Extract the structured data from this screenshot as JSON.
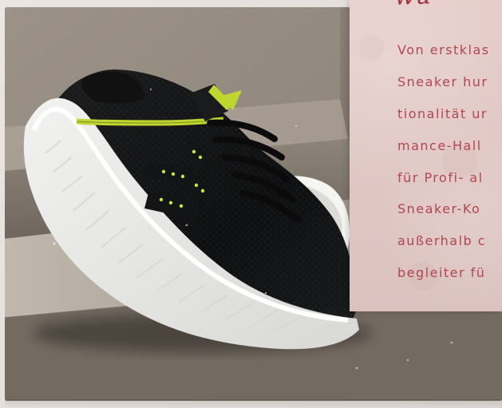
{
  "text_card": {
    "heading": "wu",
    "lines": [
      "Von erstklas",
      "Sneaker hur",
      "tionalität ur",
      "mance-Hall",
      "für Profi- al",
      "Sneaker-Ko",
      "außerhalb c",
      "begleiter fü"
    ]
  },
  "colors": {
    "accent": "#b04750",
    "heading": "#9f3340",
    "card_bg": "#dec5c2",
    "shoe_accent": "#bfd62f"
  }
}
